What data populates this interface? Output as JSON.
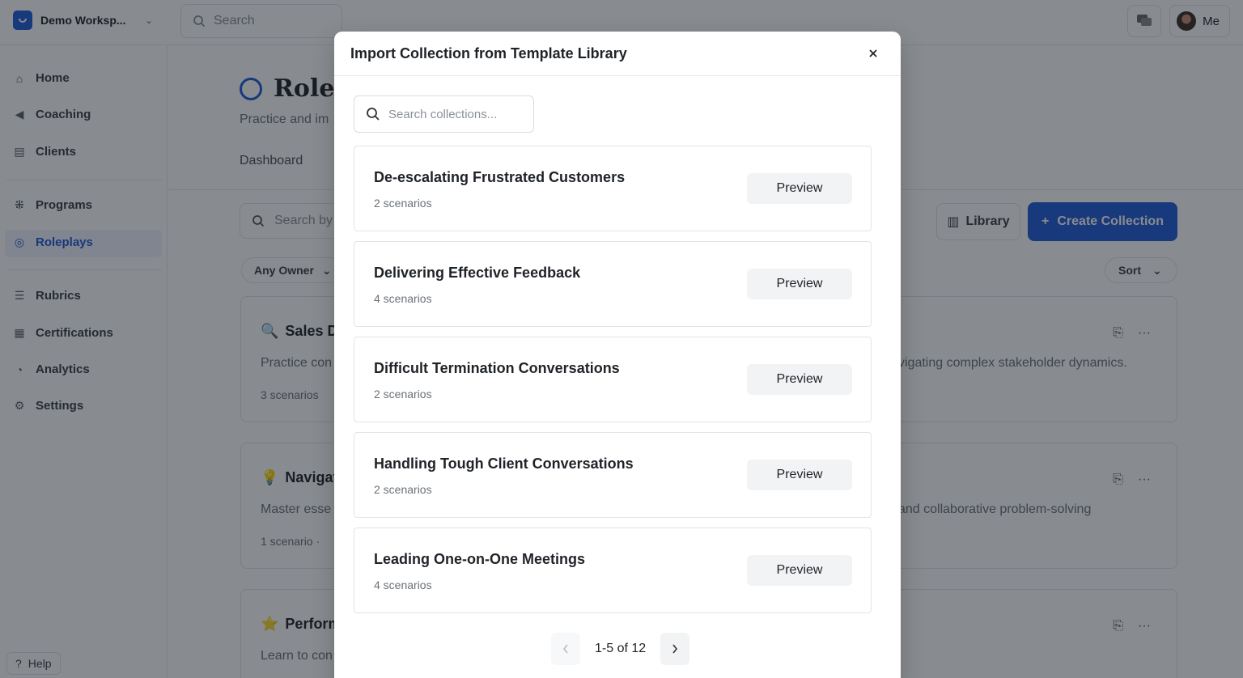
{
  "topbar": {
    "workspace_name": "Demo Worksp...",
    "search_placeholder": "Search",
    "user_label": "Me"
  },
  "sidebar": {
    "items": [
      {
        "label": "Home",
        "icon": "home-icon"
      },
      {
        "label": "Coaching",
        "icon": "megaphone-icon"
      },
      {
        "label": "Clients",
        "icon": "clients-icon"
      },
      {
        "label": "Programs",
        "icon": "programs-icon"
      },
      {
        "label": "Roleplays",
        "icon": "target-icon",
        "active": true
      },
      {
        "label": "Rubrics",
        "icon": "rubrics-icon"
      },
      {
        "label": "Certifications",
        "icon": "certifications-icon"
      },
      {
        "label": "Analytics",
        "icon": "analytics-icon"
      },
      {
        "label": "Settings",
        "icon": "gear-icon"
      }
    ],
    "help_label": "Help"
  },
  "main": {
    "title": "Rolep",
    "subtitle": "Practice and im",
    "tab_dashboard": "Dashboard",
    "search_placeholder": "Search by",
    "library_label": "Library",
    "create_label": "Create Collection",
    "owner_filter": "Any Owner",
    "sort_label": "Sort",
    "cards": [
      {
        "emoji": "🔍",
        "title": "Sales D",
        "desc_left": "Practice con",
        "desc_right": "vigating complex stakeholder dynamics.",
        "meta": "3 scenarios"
      },
      {
        "emoji": "💡",
        "title": "Navigat",
        "desc_left": "Master esse",
        "desc_right": "and collaborative problem-solving",
        "meta": "1 scenario ·"
      },
      {
        "emoji": "⭐",
        "title": "Perform",
        "desc_left": "Learn to con",
        "desc_right": "",
        "meta": ""
      }
    ]
  },
  "modal": {
    "title": "Import Collection from Template Library",
    "search_placeholder": "Search collections...",
    "collections": [
      {
        "title": "De-escalating Frustrated Customers",
        "count": "2 scenarios",
        "action": "Preview"
      },
      {
        "title": "Delivering Effective Feedback",
        "count": "4 scenarios",
        "action": "Preview"
      },
      {
        "title": "Difficult Termination Conversations",
        "count": "2 scenarios",
        "action": "Preview"
      },
      {
        "title": "Handling Tough Client Conversations",
        "count": "2 scenarios",
        "action": "Preview"
      },
      {
        "title": "Leading One-on-One Meetings",
        "count": "4 scenarios",
        "action": "Preview"
      }
    ],
    "pagination": {
      "text": "1-5 of 12",
      "prev_disabled": true
    }
  },
  "colors": {
    "accent": "#1e5bd6",
    "overlay": "rgba(17,24,32,0.5)"
  }
}
